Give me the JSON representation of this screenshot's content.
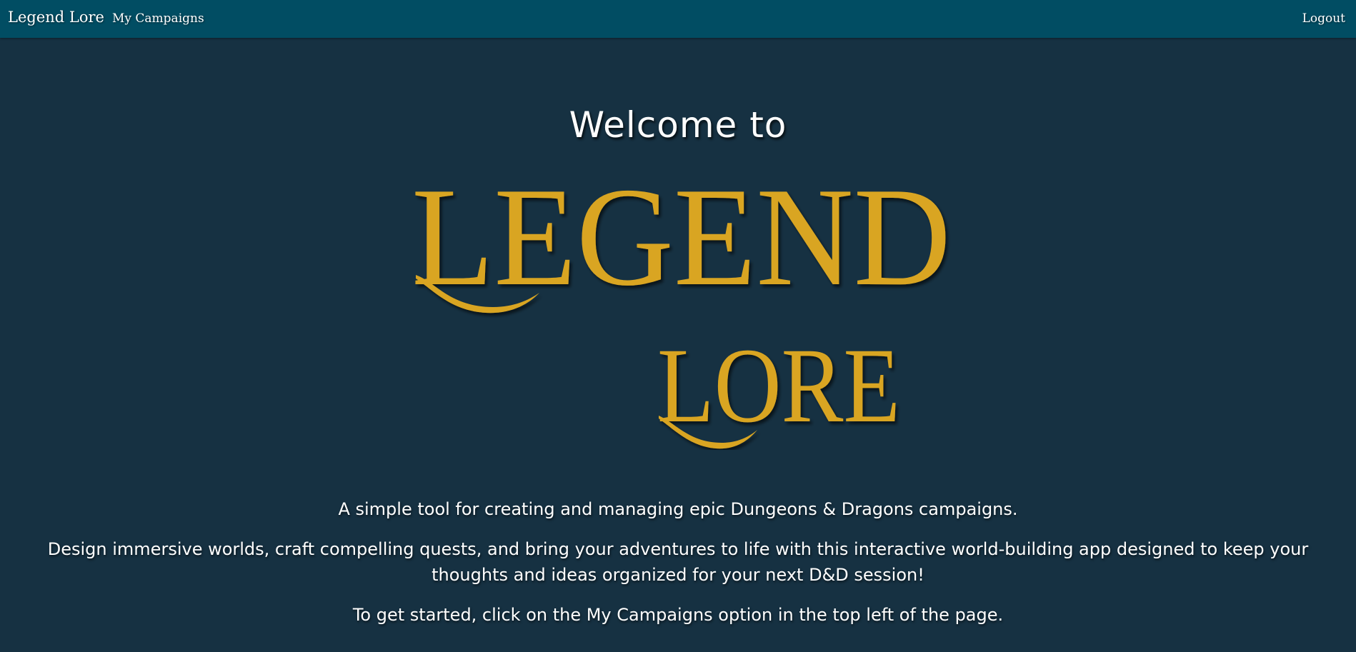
{
  "nav": {
    "brand": "Legend Lore",
    "campaigns_link": "My Campaigns",
    "logout_link": "Logout"
  },
  "hero": {
    "welcome": "Welcome to",
    "logo_word_1": "LEGEND",
    "logo_word_2": "LORE"
  },
  "content": {
    "paragraph_1": "A simple tool for creating and managing epic Dungeons & Dragons campaigns.",
    "paragraph_2": "Design immersive worlds, craft compelling quests, and bring your adventures to life with this interactive world-building app designed to keep your thoughts and ideas organized for your next D&D session!",
    "paragraph_3": "To get started, click on the My Campaigns option in the top left of the page."
  },
  "colors": {
    "navbar": "#014d63",
    "background": "#163142",
    "logo_gold": "#d9a521"
  }
}
